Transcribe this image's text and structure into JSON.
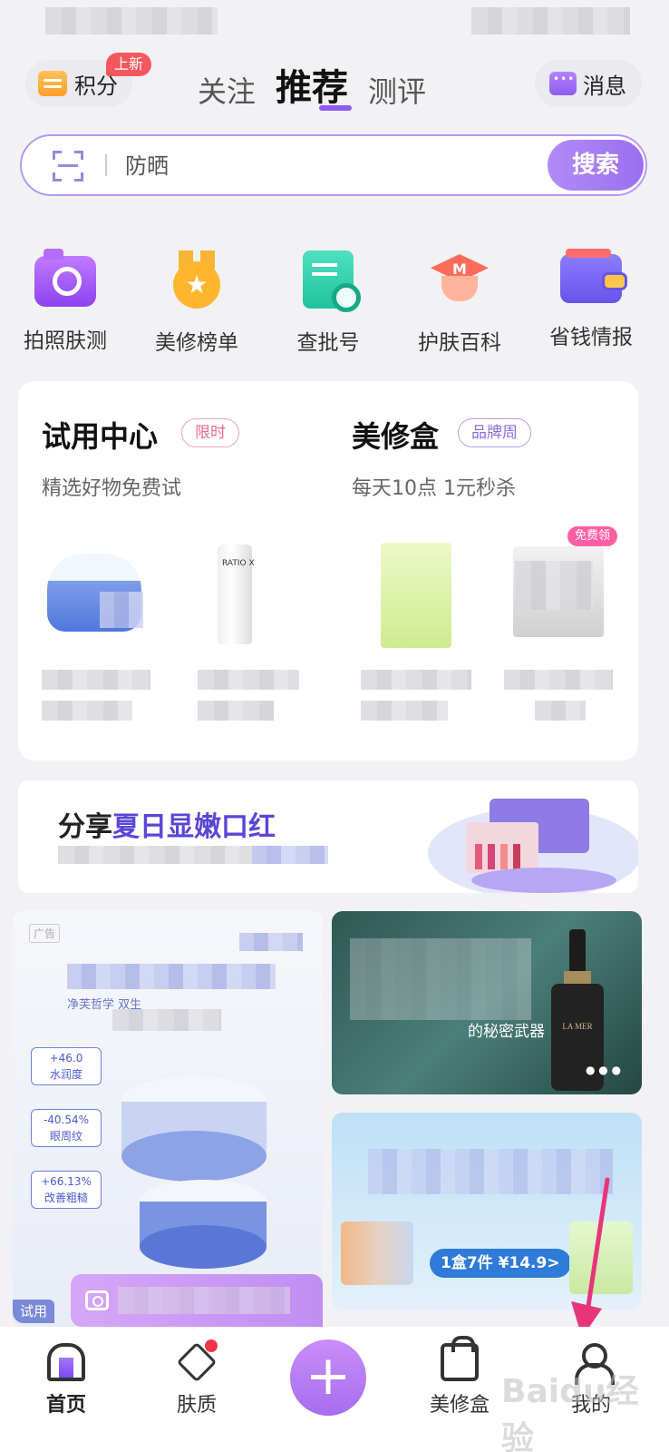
{
  "header": {
    "points_label": "积分",
    "new_badge": "上新",
    "tabs": [
      {
        "label": "关注"
      },
      {
        "label": "推荐"
      },
      {
        "label": "测评"
      }
    ],
    "message_label": "消息"
  },
  "search": {
    "value": "防晒",
    "button_label": "搜索"
  },
  "quick_actions": [
    {
      "label": "拍照肤测",
      "icon": "camera-icon"
    },
    {
      "label": "美修榜单",
      "icon": "medal-icon"
    },
    {
      "label": "查批号",
      "icon": "document-search-icon"
    },
    {
      "label": "护肤百科",
      "icon": "graduation-cap-icon"
    },
    {
      "label": "省钱情报",
      "icon": "wallet-icon"
    }
  ],
  "trial_center": {
    "title": "试用中心",
    "tag": "限时",
    "subtitle": "精选好物免费试",
    "products": [
      {
        "name": ""
      },
      {
        "name": "RATIO X"
      }
    ]
  },
  "beauty_box": {
    "title": "美修盒",
    "tag": "品牌周",
    "subtitle": "每天10点 1元秒杀",
    "free_badge": "免费领"
  },
  "share_banner": {
    "prefix": "分享",
    "highlight": "夏日显嫩口红"
  },
  "feed": {
    "left_card": {
      "ad_tag": "广告",
      "subtitle": "净芙哲学 双生",
      "stats": [
        {
          "value": "+46.0",
          "label": "水润度"
        },
        {
          "value": "-40.54%",
          "label": "眼周纹"
        },
        {
          "value": "+66.13%",
          "label": "改善粗糙"
        }
      ],
      "try_tag": "试用"
    },
    "right_top_card": {
      "text": "的秘密武器",
      "brand": "LA MER"
    },
    "right_bottom_card": {
      "price_pill": "1盒7件 ¥14.9>"
    }
  },
  "bottom_nav": [
    {
      "label": "首页",
      "icon": "home-icon",
      "active": true
    },
    {
      "label": "肤质",
      "icon": "skin-icon"
    },
    {
      "label": "",
      "icon": "plus-icon"
    },
    {
      "label": "美修盒",
      "icon": "bag-icon"
    },
    {
      "label": "我的",
      "icon": "profile-icon"
    }
  ],
  "watermark": "Baidu经验",
  "colors": {
    "accent": "#8e5cf0",
    "new_badge": "#f5585c",
    "arrow": "#e8357a"
  }
}
